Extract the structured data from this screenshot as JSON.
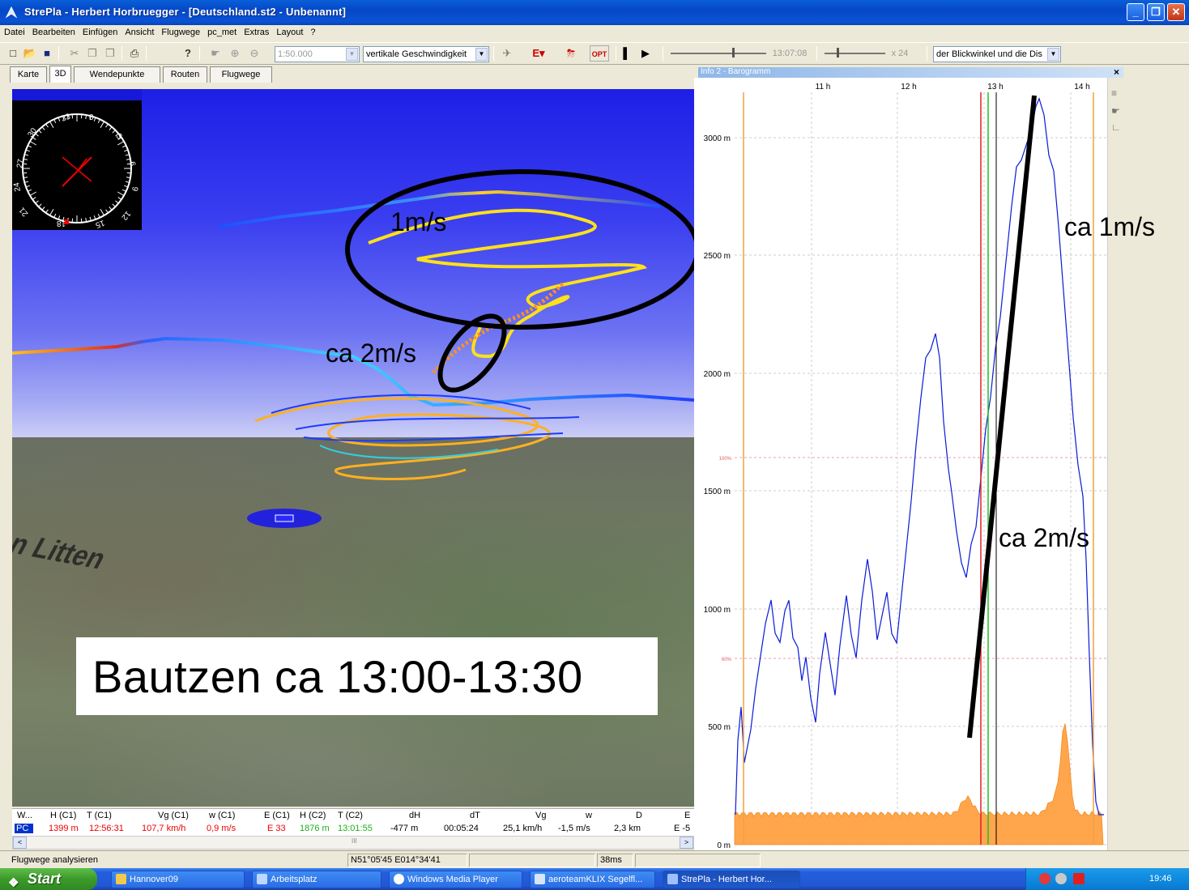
{
  "window": {
    "title": "StrePla - Herbert Horbruegger - [Deutschland.st2 - Unbenannt]",
    "minimize": "_",
    "maximize": "❐",
    "close": "✕"
  },
  "menu": [
    "Datei",
    "Bearbeiten",
    "Einfügen",
    "Ansicht",
    "Flugwege",
    "pc_met",
    "Extras",
    "Layout",
    "?"
  ],
  "toolbar": {
    "scale_value": "1:50.000",
    "color_mode": "vertikale Geschwindigkeit",
    "opt_label": "OPT",
    "time_value": "13:07:08",
    "speed_value": "x 24",
    "view_option": "der Blickwinkel und die Dis"
  },
  "tabs": [
    {
      "label": "Karte",
      "active": false
    },
    {
      "label": "3D",
      "active": true
    },
    {
      "label": "Wendepunkte",
      "active": false
    },
    {
      "label": "Routen",
      "active": false
    },
    {
      "label": "Flugwege",
      "active": false
    }
  ],
  "view3d": {
    "compass_labels": [
      "33",
      "0",
      "3",
      "30",
      "6",
      "27",
      "9",
      "24",
      "12",
      "21",
      "18",
      "15"
    ],
    "place_label": "Bautzen Litten",
    "label_box": "Bautzen ca 13:00-13:30",
    "callout_1": "1m/s",
    "callout_2": "ca 2m/s"
  },
  "grid": {
    "headers": [
      "W...",
      "H (C1)",
      "T (C1)",
      "Vg (C1)",
      "w (C1)",
      "E (C1)",
      "H (C2)",
      "T (C2)",
      "dH",
      "dT",
      "Vg",
      "w",
      "D",
      "E"
    ],
    "row": {
      "pilot": "PC",
      "h_c1": "1399 m",
      "t_c1": "12:56:31",
      "vg_c1": "107,7 km/h",
      "w_c1": "0,9 m/s",
      "e_c1": "E 33",
      "h_c2": "1876 m",
      "t_c2": "13:01:55",
      "dh": "-477 m",
      "dt": "00:05:24",
      "vg": "25,1 km/h",
      "w": "-1,5 m/s",
      "d": "2,3 km",
      "e": "E -5"
    },
    "scroll_left": "<",
    "scroll_right": ">",
    "scroll_thumb": "III"
  },
  "statusbar": {
    "message": "Flugwege analysieren",
    "coords": "N51°05'45 E014°34'41",
    "timing": "38ms"
  },
  "barogram": {
    "caption": "Info 2 - Barogramm",
    "close": "×",
    "time_labels": [
      "11 h",
      "12 h",
      "13 h",
      "14 h"
    ],
    "y_labels": [
      "3000 m",
      "2500 m",
      "2000 m",
      "1500 m",
      "1000 m",
      "500 m",
      "0 m"
    ],
    "pct_labels": [
      "100%",
      "60%"
    ],
    "callout_top": "ca 1m/s",
    "callout_bottom": "ca 2m/s"
  },
  "taskbar": {
    "start": "Start",
    "tasks": [
      {
        "label": "Hannover09",
        "active": false
      },
      {
        "label": "Arbeitsplatz",
        "active": false
      },
      {
        "label": "Windows Media Player",
        "active": false
      },
      {
        "label": "aeroteamKLIX Segelfl...",
        "active": false
      },
      {
        "label": "StrePla - Herbert Hor...",
        "active": true
      }
    ],
    "clock": "19:46"
  }
}
